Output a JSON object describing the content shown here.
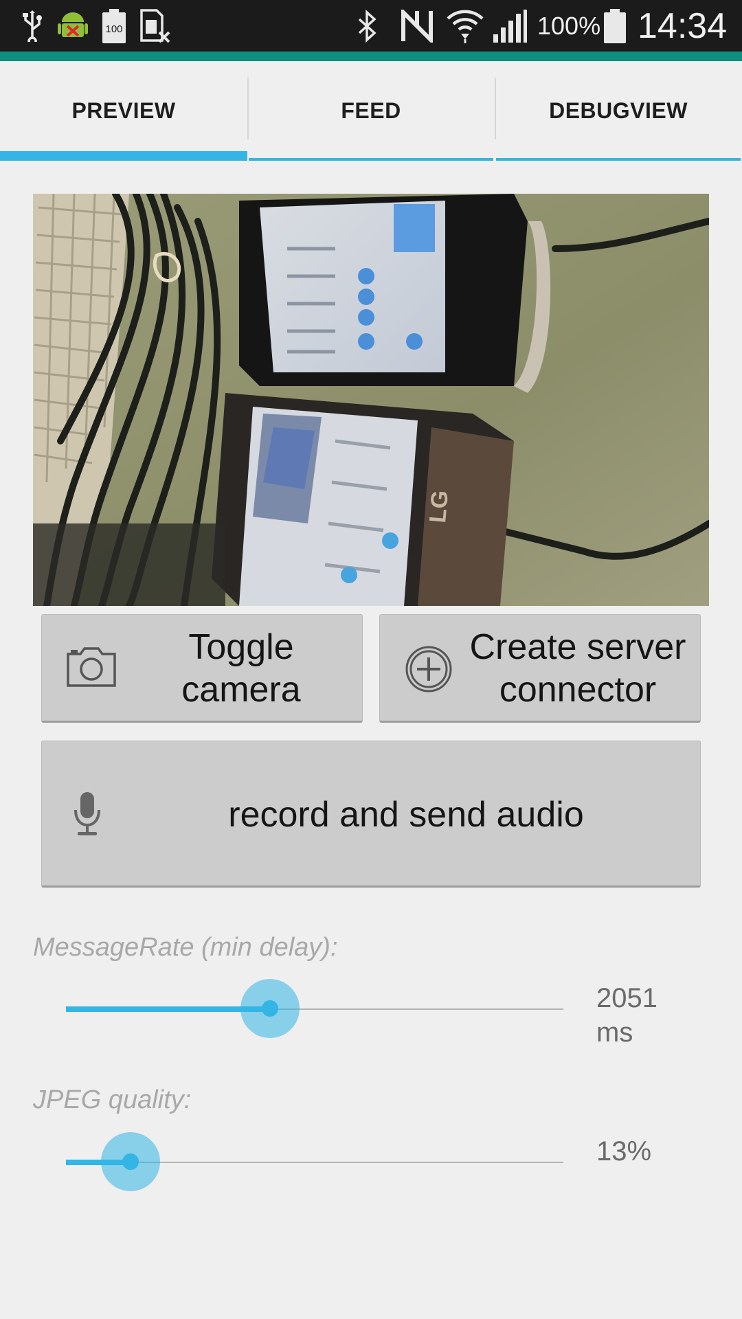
{
  "status_bar": {
    "icons": [
      "usb-icon",
      "android-debug-icon",
      "battery-100-icon",
      "sim-card-off-icon",
      "bluetooth-icon",
      "nfc-icon",
      "wifi-icon",
      "signal-icon",
      "battery-icon"
    ],
    "battery_small_label": "100",
    "battery_percent": "100%",
    "time": "14:34"
  },
  "tabs": [
    {
      "label": "PREVIEW",
      "active": true
    },
    {
      "label": "FEED",
      "active": false
    },
    {
      "label": "DEBUGVIEW",
      "active": false
    }
  ],
  "camera_preview": {
    "phone_logo": "LG"
  },
  "buttons": {
    "toggle_camera": {
      "label_line1": "Toggle",
      "label_line2": "camera",
      "icon": "camera-icon"
    },
    "create_server": {
      "label_line1": "Create server",
      "label_line2": "connector",
      "icon": "add-circle-icon"
    },
    "record_audio": {
      "label": "record and send audio",
      "icon": "microphone-icon"
    }
  },
  "sliders": {
    "message_rate": {
      "label": "MessageRate (min delay):",
      "value_line1": "2051",
      "value_line2": "ms",
      "fraction": 0.41
    },
    "jpeg_quality": {
      "label": "JPEG quality:",
      "value": "13%",
      "fraction": 0.13
    }
  },
  "colors": {
    "accent": "#33b5e5",
    "status_bar": "#1b1b1b",
    "status_strip": "#0d8f7f",
    "button_bg": "#cccccc"
  }
}
